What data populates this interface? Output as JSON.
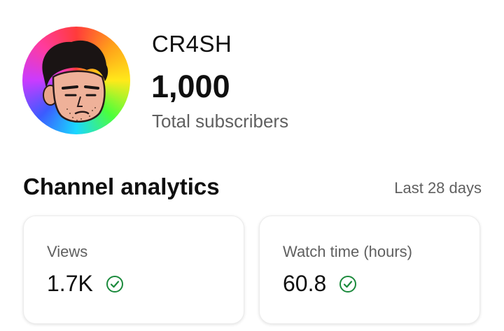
{
  "channel": {
    "name": "CR4SH",
    "subscriber_count": "1,000",
    "subscriber_label": "Total subscribers",
    "avatar_icon": "cartoon-face-avatar"
  },
  "analytics": {
    "title": "Channel analytics",
    "period": "Last 28 days",
    "cards": [
      {
        "label": "Views",
        "value": "1.7K",
        "status_icon": "check-circle-icon"
      },
      {
        "label": "Watch time (hours)",
        "value": "60.8",
        "status_icon": "check-circle-icon"
      }
    ]
  },
  "colors": {
    "check": "#1b8a3c",
    "secondary_text": "#606060",
    "primary_text": "#0f0f0f"
  }
}
